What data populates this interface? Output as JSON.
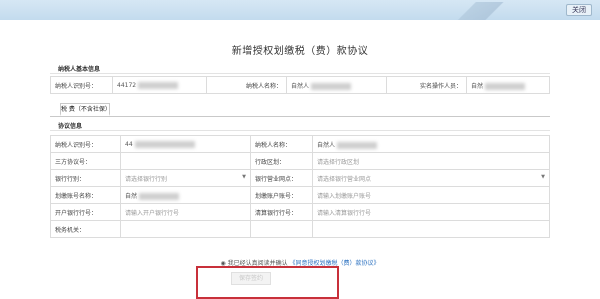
{
  "header": {
    "close_label": "关闭"
  },
  "page": {
    "title": "新增授权划缴税（费）款协议"
  },
  "basic_info": {
    "section_title": "纳税人基本信息",
    "fields": [
      {
        "label": "纳税人识别号：",
        "value": "44172"
      },
      {
        "label": "纳税人名称：",
        "value": "自然人"
      },
      {
        "label": "实名操作人员：",
        "value": "自然"
      }
    ]
  },
  "tab": {
    "label": "税 费（不含社保）"
  },
  "agreement": {
    "section_title": "协议信息",
    "rows": [
      {
        "l1": "纳税人识别号：",
        "v1": "44",
        "l2": "纳税人名称：",
        "v2": "自然人"
      },
      {
        "l1": "三方协议号：",
        "v1": "",
        "l2": "行政区划：",
        "v2": "请选择行政区划"
      },
      {
        "l1": "银行行别：",
        "v1": "请选择银行行别",
        "l2": "银行营业网点：",
        "v2": "请选择银行营业网点"
      },
      {
        "l1": "划缴账号名称：",
        "v1": "自然",
        "l2": "划缴账户账号：",
        "v2": "请输入划缴账户账号"
      },
      {
        "l1": "开户银行行号：",
        "v1": "请输入开户银行行号",
        "l2": "清算银行行号：",
        "v2": "请输入清算银行行号"
      },
      {
        "l1": "税务机关：",
        "v1": "",
        "l2": "",
        "v2": ""
      }
    ]
  },
  "consent": {
    "prefix": "我已经认真阅读并确认",
    "link": "《同意授权划缴税（费）款协议》"
  },
  "actions": {
    "submit_label": "保存签约"
  }
}
